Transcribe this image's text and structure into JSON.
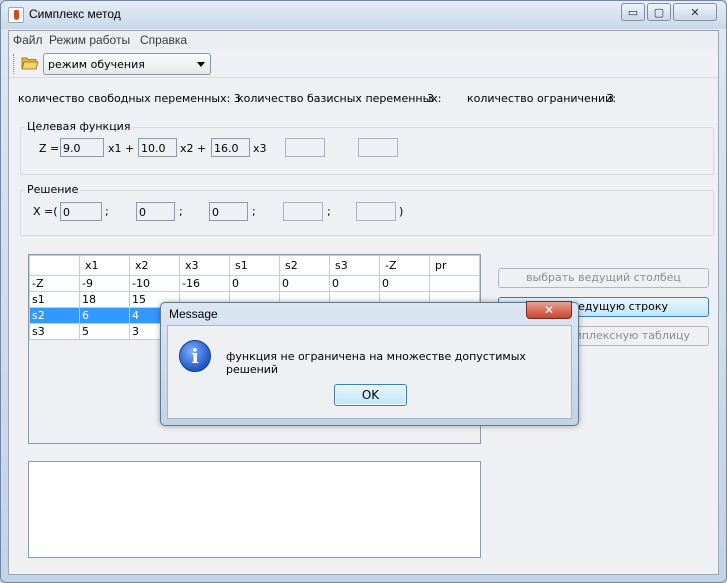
{
  "window": {
    "title": "Симплекс метод",
    "min_glyph": "▭",
    "max_glyph": "▢",
    "close_glyph": "✕"
  },
  "menu": [
    "Файл",
    "Режим работы",
    "Справка"
  ],
  "toolbar": {
    "mode_value": "режим обучения"
  },
  "info": {
    "free_vars_label": "количество свободных переменных: 3",
    "basic_vars_label": "количество базисных переменных:",
    "basic_vars_value": "3",
    "constraints_label": "количество ограничений:",
    "constraints_value": "3"
  },
  "objective": {
    "group_label": "Целевая функция",
    "prefix": "Z =",
    "c1": "9.0",
    "t1": "x1 +",
    "c2": "10.0",
    "t2": "x2 +",
    "c3": "16.0",
    "t3": "x3"
  },
  "solution": {
    "group_label": "Решение",
    "prefix": "X =(",
    "x1": "0",
    "x2": "0",
    "x3": "0",
    "sep": ";",
    "close": ")"
  },
  "table": {
    "headers": [
      "",
      "x1",
      "x2",
      "x3",
      "s1",
      "s2",
      "s3",
      "-Z",
      "pr"
    ],
    "rows": [
      [
        "-Z",
        "-9",
        "-10",
        "-16",
        "0",
        "0",
        "0",
        "0",
        ""
      ],
      [
        "s1",
        "18",
        "15",
        "",
        "",
        "",
        "",
        "",
        ""
      ],
      [
        "s2",
        "6",
        "4",
        "",
        "",
        "",
        "",
        "",
        ""
      ],
      [
        "s3",
        "5",
        "3",
        "",
        "",
        "",
        "",
        "",
        ""
      ]
    ]
  },
  "buttons": {
    "choose_column": "выбрать ведущий столбец",
    "choose_row": "ведущую строку",
    "simplex_table": "симплексную таблицу"
  },
  "dialog": {
    "title": "Message",
    "close": "✕",
    "icon": "i",
    "message": "функция не ограничена на множестве допустимых решений",
    "ok": "OK"
  }
}
